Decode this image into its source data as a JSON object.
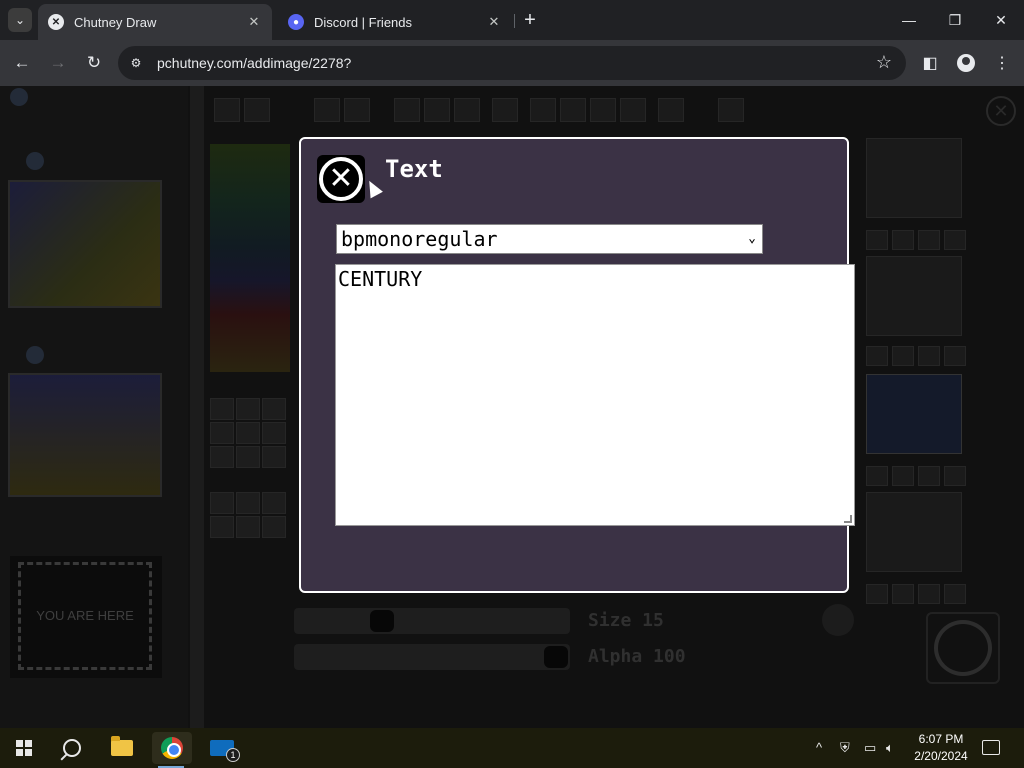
{
  "browser": {
    "tabs": [
      {
        "title": "Chutney Draw",
        "active": true,
        "favicon": "chutney-icon"
      },
      {
        "title": "Discord | Friends",
        "active": false,
        "favicon": "discord-icon"
      }
    ],
    "tab_close": "✕",
    "new_tab": "+",
    "url": "pchutney.com/addimage/2278?",
    "window_controls": {
      "minimize": "—",
      "maximize": "❐",
      "close": "✕"
    }
  },
  "app": {
    "you_are_here": "YOU ARE HERE",
    "slider_size_label": "Size 15",
    "slider_alpha_label": "Alpha 100",
    "size_value": 15,
    "alpha_value": 100
  },
  "modal": {
    "title": "Text",
    "font_select_value": "bpmonoregular",
    "text_value": "CENTURY"
  },
  "taskbar": {
    "time": "6:07 PM",
    "date": "2/20/2024",
    "mail_badge": "1"
  },
  "colors": {
    "modal_bg": "#3b3245",
    "modal_border": "#ffffff",
    "taskbar_bg": "#1c1c0c"
  }
}
